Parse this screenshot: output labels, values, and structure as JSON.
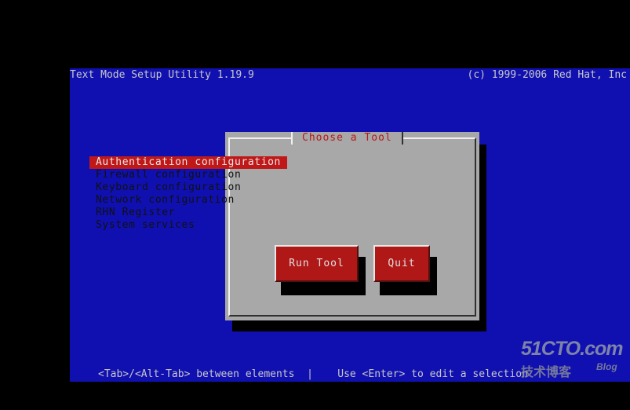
{
  "header": {
    "app_title": "Text Mode Setup Utility 1.19.9",
    "copyright": "(c) 1999-2006 Red Hat, Inc"
  },
  "dialog": {
    "title": "Choose a Tool",
    "items": [
      {
        "label": "Authentication configuration",
        "selected": true
      },
      {
        "label": "Firewall configuration",
        "selected": false
      },
      {
        "label": "Keyboard configuration",
        "selected": false
      },
      {
        "label": "Network configuration",
        "selected": false
      },
      {
        "label": "RHN Register",
        "selected": false
      },
      {
        "label": "System services",
        "selected": false
      }
    ],
    "buttons": {
      "run_tool": "Run Tool",
      "quit": "Quit"
    }
  },
  "footer": {
    "help_text": "<Tab>/<Alt-Tab> between elements  |    Use <Enter> to edit a selection"
  },
  "watermark": {
    "logo": "51CTO.com",
    "subtitle": "技术博客",
    "blog": "Blog"
  },
  "colors": {
    "screen_background": "#1010b0",
    "dialog_background": "#a8a8a8",
    "selection": "#c01818",
    "title_text": "#b81818"
  }
}
